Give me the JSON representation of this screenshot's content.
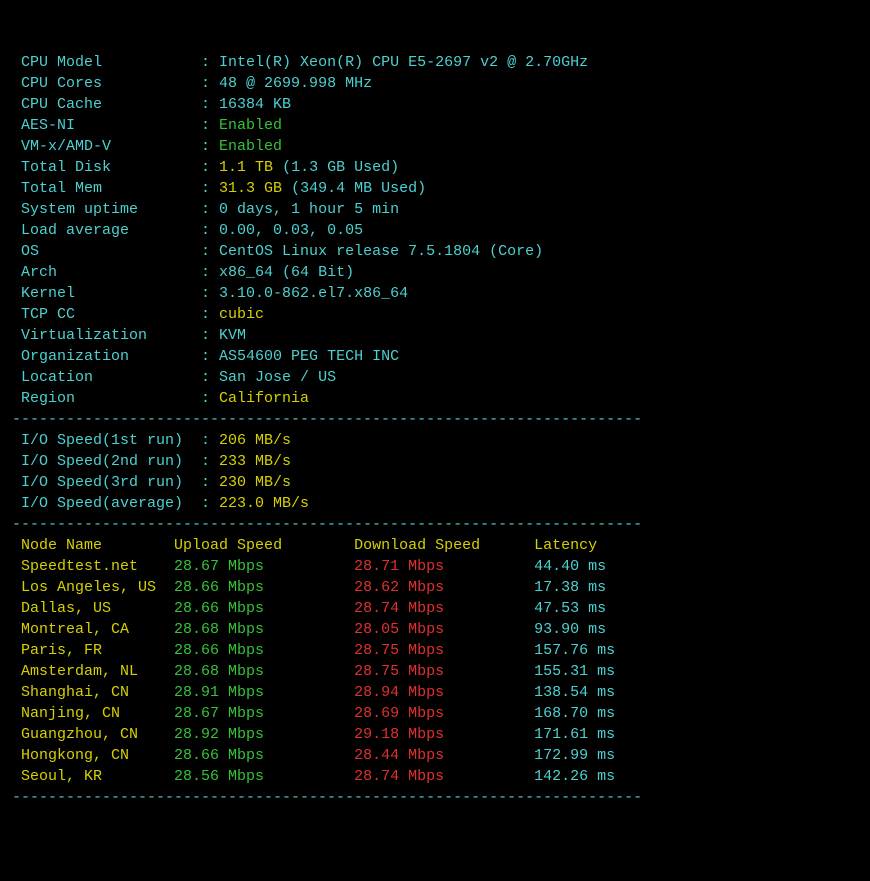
{
  "sys": [
    {
      "label": "CPU Model",
      "value": "Intel(R) Xeon(R) CPU E5-2697 v2 @ 2.70GHz",
      "color": "cyan"
    },
    {
      "label": "CPU Cores",
      "value": "48 @ 2699.998 MHz",
      "color": "cyan"
    },
    {
      "label": "CPU Cache",
      "value": "16384 KB",
      "color": "cyan"
    },
    {
      "label": "AES-NI",
      "value": "Enabled",
      "color": "green"
    },
    {
      "label": "VM-x/AMD-V",
      "value": "Enabled",
      "color": "green"
    },
    {
      "label": "Total Disk",
      "value": "1.1 TB",
      "color": "yellow",
      "extra": " (1.3 GB Used)",
      "extra_color": "cyan"
    },
    {
      "label": "Total Mem",
      "value": "31.3 GB",
      "color": "yellow",
      "extra": " (349.4 MB Used)",
      "extra_color": "cyan"
    },
    {
      "label": "System uptime",
      "value": "0 days, 1 hour 5 min",
      "color": "cyan"
    },
    {
      "label": "Load average",
      "value": "0.00, 0.03, 0.05",
      "color": "cyan"
    },
    {
      "label": "OS",
      "value": "CentOS Linux release 7.5.1804 (Core)",
      "color": "cyan"
    },
    {
      "label": "Arch",
      "value": "x86_64 (64 Bit)",
      "color": "cyan"
    },
    {
      "label": "Kernel",
      "value": "3.10.0-862.el7.x86_64",
      "color": "cyan"
    },
    {
      "label": "TCP CC",
      "value": "cubic",
      "color": "yellow"
    },
    {
      "label": "Virtualization",
      "value": "KVM",
      "color": "cyan"
    },
    {
      "label": "Organization",
      "value": "AS54600 PEG TECH INC",
      "color": "cyan"
    },
    {
      "label": "Location",
      "value": "San Jose / US",
      "color": "cyan"
    },
    {
      "label": "Region",
      "value": "California",
      "color": "yellow"
    }
  ],
  "io": [
    {
      "label": "I/O Speed(1st run)",
      "value": "206 MB/s"
    },
    {
      "label": "I/O Speed(2nd run)",
      "value": "233 MB/s"
    },
    {
      "label": "I/O Speed(3rd run)",
      "value": "230 MB/s"
    },
    {
      "label": "I/O Speed(average)",
      "value": "223.0 MB/s"
    }
  ],
  "speed_header": {
    "c0": "Node Name",
    "c1": "Upload Speed",
    "c2": "Download Speed",
    "c3": "Latency"
  },
  "speed": [
    {
      "node": "Speedtest.net",
      "up": "28.67 Mbps",
      "down": "28.71 Mbps",
      "lat": "44.40 ms"
    },
    {
      "node": "Los Angeles, US",
      "up": "28.66 Mbps",
      "down": "28.62 Mbps",
      "lat": "17.38 ms"
    },
    {
      "node": "Dallas, US",
      "up": "28.66 Mbps",
      "down": "28.74 Mbps",
      "lat": "47.53 ms"
    },
    {
      "node": "Montreal, CA",
      "up": "28.68 Mbps",
      "down": "28.05 Mbps",
      "lat": "93.90 ms"
    },
    {
      "node": "Paris, FR",
      "up": "28.66 Mbps",
      "down": "28.75 Mbps",
      "lat": "157.76 ms"
    },
    {
      "node": "Amsterdam, NL",
      "up": "28.68 Mbps",
      "down": "28.75 Mbps",
      "lat": "155.31 ms"
    },
    {
      "node": "Shanghai, CN",
      "up": "28.91 Mbps",
      "down": "28.94 Mbps",
      "lat": "138.54 ms"
    },
    {
      "node": "Nanjing, CN",
      "up": "28.67 Mbps",
      "down": "28.69 Mbps",
      "lat": "168.70 ms"
    },
    {
      "node": "Guangzhou, CN",
      "up": "28.92 Mbps",
      "down": "29.18 Mbps",
      "lat": "171.61 ms"
    },
    {
      "node": "Hongkong, CN",
      "up": "28.66 Mbps",
      "down": "28.44 Mbps",
      "lat": "172.99 ms"
    },
    {
      "node": "Seoul, KR",
      "up": "28.56 Mbps",
      "down": "28.74 Mbps",
      "lat": "142.26 ms"
    }
  ],
  "dash": "----------------------------------------------------------------------"
}
